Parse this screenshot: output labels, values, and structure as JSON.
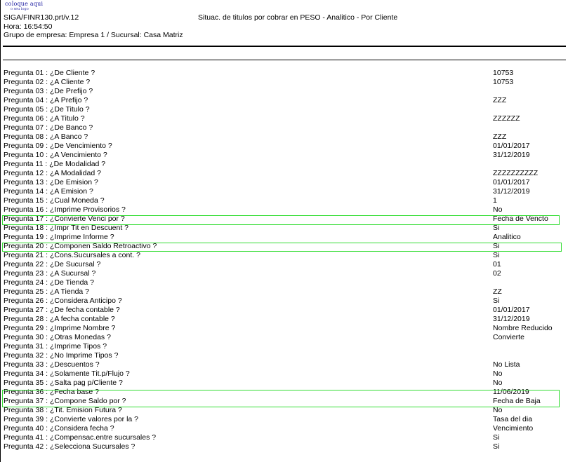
{
  "logo": {
    "line1": "coloque aqui",
    "line2": "o seu logo"
  },
  "header": {
    "program": "SIGA/FINR130.prt/v.12",
    "time": "Hora: 16:54:50",
    "group": "Grupo de empresa: Empresa 1 / Sucursal: Casa Matriz",
    "title": "Situac. de titulos por cobrar en PESO - Analitico - Por Cliente"
  },
  "questions": [
    {
      "label": "Pregunta 01 : ¿De Cliente ?",
      "value": "10753"
    },
    {
      "label": "Pregunta 02 : ¿A Cliente ?",
      "value": "10753"
    },
    {
      "label": "Pregunta 03 : ¿De Prefijo ?",
      "value": ""
    },
    {
      "label": "Pregunta 04 : ¿A Prefijo ?",
      "value": "ZZZ"
    },
    {
      "label": "Pregunta 05 : ¿De Titulo ?",
      "value": ""
    },
    {
      "label": "Pregunta 06 : ¿A Titulo ?",
      "value": "ZZZZZZ"
    },
    {
      "label": "Pregunta 07 : ¿De Banco ?",
      "value": ""
    },
    {
      "label": "Pregunta 08 : ¿A Banco ?",
      "value": "ZZZ"
    },
    {
      "label": "Pregunta 09 : ¿De Vencimiento ?",
      "value": "01/01/2017"
    },
    {
      "label": "Pregunta 10 : ¿A Vencimiento ?",
      "value": "31/12/2019"
    },
    {
      "label": "Pregunta 11 : ¿De Modalidad ?",
      "value": ""
    },
    {
      "label": "Pregunta 12 : ¿A Modalidad ?",
      "value": "ZZZZZZZZZZ"
    },
    {
      "label": "Pregunta 13 : ¿De Emision ?",
      "value": "01/01/2017"
    },
    {
      "label": "Pregunta 14 : ¿A Emision ?",
      "value": "31/12/2019"
    },
    {
      "label": "Pregunta 15 : ¿Cual Moneda ?",
      "value": "1"
    },
    {
      "label": "Pregunta 16 : ¿Imprime Provisorios ?",
      "value": "No"
    },
    {
      "label": "Pregunta 17 : ¿Convierte Venci por ?",
      "value": "Fecha de Vencto"
    },
    {
      "label": "Pregunta 18 : ¿Impr Tit en Descuent ?",
      "value": "Si"
    },
    {
      "label": "Pregunta 19 : ¿Imprime Informe ?",
      "value": "Analitico"
    },
    {
      "label": "Pregunta 20 : ¿Componen Saldo Retroactivo ?",
      "value": "Si"
    },
    {
      "label": "Pregunta 21 : ¿Cons.Sucursales a cont. ?",
      "value": "Si"
    },
    {
      "label": "Pregunta 22 : ¿De Sucursal ?",
      "value": "01"
    },
    {
      "label": "Pregunta 23 : ¿A Sucursal ?",
      "value": "02"
    },
    {
      "label": "Pregunta 24 : ¿De Tienda ?",
      "value": ""
    },
    {
      "label": "Pregunta 25 : ¿A Tienda ?",
      "value": "ZZ"
    },
    {
      "label": "Pregunta 26 : ¿Considera Anticipo ?",
      "value": "Si"
    },
    {
      "label": "Pregunta 27 : ¿De fecha contable ?",
      "value": "01/01/2017"
    },
    {
      "label": "Pregunta 28 : ¿A fecha contable ?",
      "value": "31/12/2019"
    },
    {
      "label": "Pregunta 29 : ¿Imprime Nombre ?",
      "value": "Nombre Reducido"
    },
    {
      "label": "Pregunta 30 : ¿Otras Monedas ?",
      "value": "Convierte"
    },
    {
      "label": "Pregunta 31 : ¿Imprime Tipos ?",
      "value": ""
    },
    {
      "label": "Pregunta 32 : ¿No Imprime Tipos ?",
      "value": ""
    },
    {
      "label": "Pregunta 33 : ¿Descuentos ?",
      "value": "No Lista"
    },
    {
      "label": "Pregunta 34 : ¿Solamente Tit.p/Flujo ?",
      "value": "No"
    },
    {
      "label": "Pregunta 35 : ¿Salta pag p/Cliente ?",
      "value": "No"
    },
    {
      "label": "Pregunta 36 : ¿Fecha base ?",
      "value": "11/06/2019"
    },
    {
      "label": "Pregunta 37 : ¿Compone Saldo por ?",
      "value": "Fecha de Baja"
    },
    {
      "label": "Pregunta 38 : ¿Tit. Emision Futura ?",
      "value": "No"
    },
    {
      "label": "Pregunta 39 : ¿Convierte valores por la ?",
      "value": "Tasa del dia"
    },
    {
      "label": "Pregunta 40 : ¿Considera fecha ?",
      "value": "Vencimiento"
    },
    {
      "label": "Pregunta 41 : ¿Compensac.entre sucursales ?",
      "value": "Si"
    },
    {
      "label": "Pregunta 42 : ¿Selecciona Sucursales ?",
      "value": "Si"
    }
  ],
  "highlight_color": "#33dd33"
}
